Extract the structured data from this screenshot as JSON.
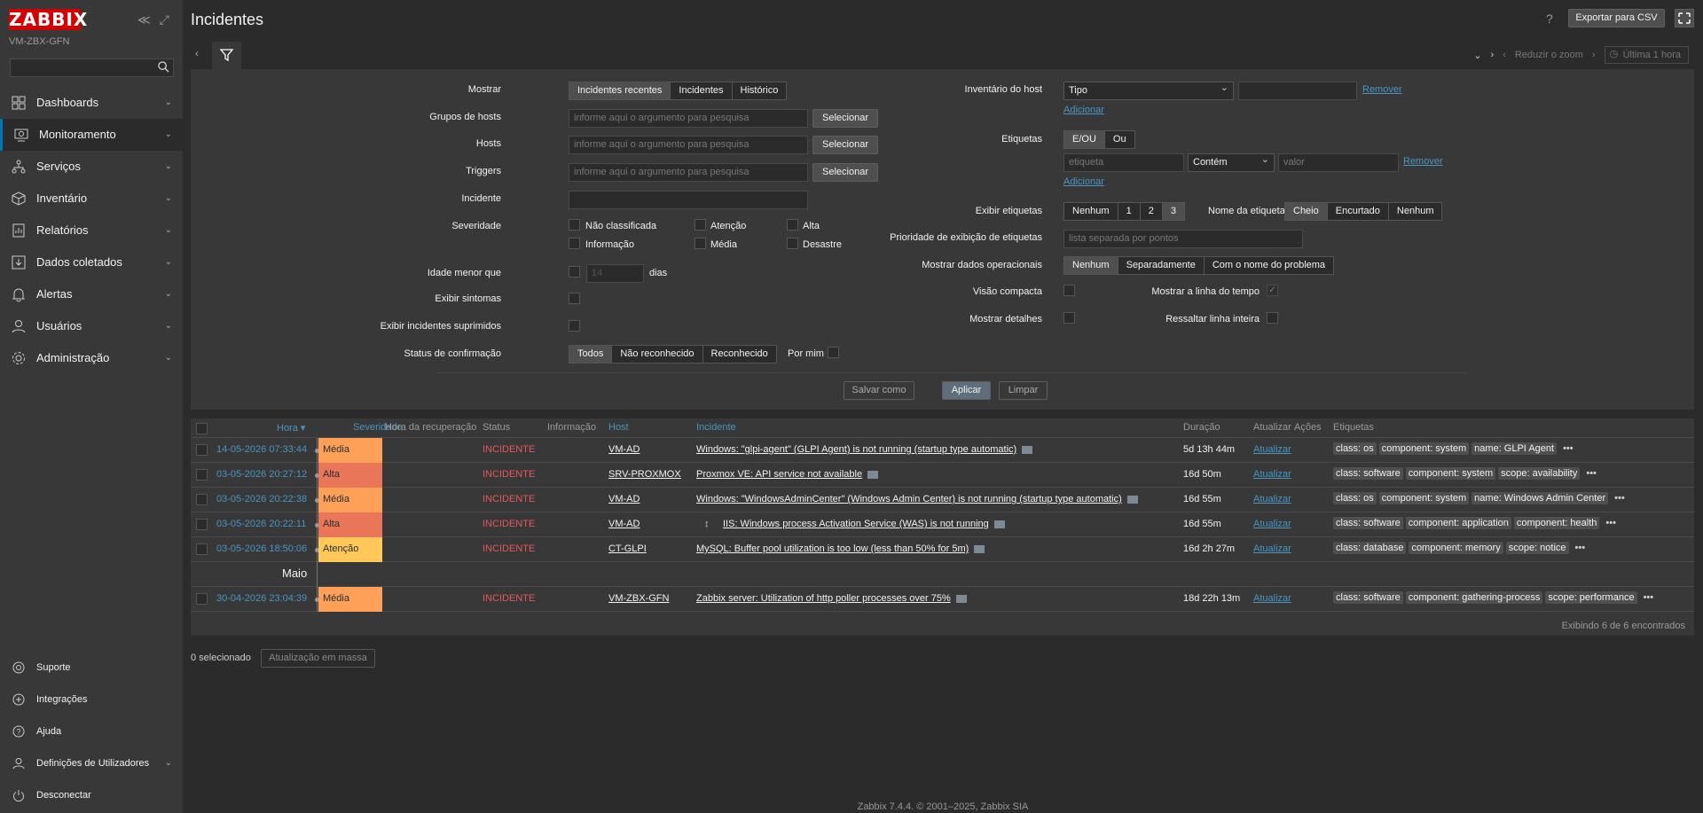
{
  "app": {
    "logo": "ZABBIX",
    "server": "VM-ZBX-GFN",
    "page_title": "Incidentes",
    "export": "Exportar para CSV",
    "help": "?"
  },
  "menu": [
    {
      "label": "Dashboards",
      "icon": "dashboards-icon"
    },
    {
      "label": "Monitoramento",
      "icon": "monitoring-icon",
      "active": true
    },
    {
      "label": "Serviços",
      "icon": "services-icon"
    },
    {
      "label": "Inventário",
      "icon": "inventory-icon"
    },
    {
      "label": "Relatórios",
      "icon": "reports-icon"
    },
    {
      "label": "Dados coletados",
      "icon": "data-collection-icon"
    },
    {
      "label": "Alertas",
      "icon": "alerts-icon"
    },
    {
      "label": "Usuários",
      "icon": "users-icon"
    },
    {
      "label": "Administração",
      "icon": "administration-icon"
    }
  ],
  "bottom_menu": [
    {
      "label": "Suporte",
      "icon": "support-icon"
    },
    {
      "label": "Integrações",
      "icon": "integrations-icon"
    },
    {
      "label": "Ajuda",
      "icon": "help-icon"
    },
    {
      "label": "Definições de Utilizadores",
      "icon": "user-settings-icon"
    },
    {
      "label": "Desconectar",
      "icon": "logout-icon"
    }
  ],
  "zoom": {
    "zoom_out": "Reduzir o zoom",
    "range": "Última 1 hora"
  },
  "filter": {
    "show_label": "Mostrar",
    "show_options": [
      "Incidentes recentes",
      "Incidentes",
      "Histórico"
    ],
    "host_groups_label": "Grupos de hosts",
    "hosts_label": "Hosts",
    "triggers_label": "Triggers",
    "placeholder": "informe aqui o argumento para pesquisa",
    "select": "Selecionar",
    "incident_label": "Incidente",
    "severity_label": "Severidade",
    "severities": [
      "Não classificada",
      "Atenção",
      "Alta",
      "Informação",
      "Média",
      "Desastre"
    ],
    "age_label": "Idade menor que",
    "age_value": "14",
    "age_unit": "dias",
    "symptoms_label": "Exibir sintomas",
    "suppressed_label": "Exibir incidentes suprimidos",
    "ack_label": "Status de confirmação",
    "ack_options": [
      "Todos",
      "Não reconhecido",
      "Reconhecido"
    ],
    "by_me": "Por mim",
    "inventory_label": "Inventário do host",
    "inventory_type": "Tipo",
    "remove": "Remover",
    "add": "Adicionar",
    "tags_label": "Etiquetas",
    "tags_ops": [
      "E/OU",
      "Ou"
    ],
    "tag_placeholder": "etiqueta",
    "tag_op": "Contém",
    "value_placeholder": "valor",
    "show_tags_label": "Exibir etiquetas",
    "show_tags_opts": [
      "Nenhum",
      "1",
      "2",
      "3"
    ],
    "tag_name_label": "Nome da etiqueta",
    "tag_name_opts": [
      "Cheio",
      "Encurtado",
      "Nenhum"
    ],
    "tag_priority_label": "Prioridade de exibição de etiquetas",
    "tag_priority_placeholder": "lista separada por pontos",
    "opdata_label": "Mostrar dados operacionais",
    "opdata_opts": [
      "Nenhum",
      "Separadamente",
      "Com o nome do problema"
    ],
    "compact_label": "Visão compacta",
    "timeline_label": "Mostrar a linha do tempo",
    "details_label": "Mostrar detalhes",
    "highlight_label": "Ressaltar linha inteira",
    "save_as": "Salvar como",
    "apply": "Aplicar",
    "reset": "Limpar"
  },
  "table": {
    "headers": [
      "Hora ▾",
      "Severidade",
      "Hora da recuperação",
      "Status",
      "Informação",
      "Host",
      "Incidente",
      "Duração",
      "Atualizar",
      "Ações",
      "Etiquetas"
    ],
    "rows": [
      {
        "time": "14-05-2026 07:33:44",
        "sev": "Média",
        "color": "#ffa059",
        "status": "INCIDENTE",
        "host": "VM-AD",
        "problem": "Windows: \"glpi-agent\" (GLPI Agent) is not running (startup type automatic)",
        "dur": "5d 13h 44m",
        "upd": "Atualizar",
        "tags": [
          "class: os",
          "component: system",
          "name: GLPI Agent"
        ]
      },
      {
        "time": "03-05-2026 20:27:12",
        "sev": "Alta",
        "color": "#e97659",
        "status": "INCIDENTE",
        "host": "SRV-PROXMOX",
        "problem": "Proxmox VE: API service not available",
        "dur": "16d 50m",
        "upd": "Atualizar",
        "tags": [
          "class: software",
          "component: system",
          "scope: availability"
        ]
      },
      {
        "time": "03-05-2026 20:22:38",
        "sev": "Média",
        "color": "#ffa059",
        "status": "INCIDENTE",
        "host": "VM-AD",
        "problem": "Windows: \"WindowsAdminCenter\" (Windows Admin Center) is not running (startup type automatic)",
        "dur": "16d 55m",
        "upd": "Atualizar",
        "tags": [
          "class: os",
          "component: system",
          "name: Windows Admin Center"
        ]
      },
      {
        "time": "03-05-2026 20:22:11",
        "sev": "Alta",
        "color": "#e97659",
        "status": "INCIDENTE",
        "host": "VM-AD",
        "problem": "IIS: Windows process Activation Service (WAS) is not running",
        "dur": "16d 55m",
        "upd": "Atualizar",
        "tags": [
          "class: software",
          "component: application",
          "component: health"
        ],
        "dep": true
      },
      {
        "time": "03-05-2026 18:50:06",
        "sev": "Atenção",
        "color": "#ffc859",
        "status": "INCIDENTE",
        "host": "CT-GLPI",
        "problem": "MySQL: Buffer pool utilization is too low (less than 50% for 5m)",
        "dur": "16d 2h 27m",
        "upd": "Atualizar",
        "tags": [
          "class: database",
          "component: memory",
          "scope: notice"
        ]
      },
      {
        "time": "30-04-2026 23:04:39",
        "sev": "Média",
        "color": "#ffa059",
        "status": "INCIDENTE",
        "host": "VM-ZBX-GFN",
        "problem": "Zabbix server: Utilization of http poller processes over 75%",
        "dur": "18d 22h 13m",
        "upd": "Atualizar",
        "tags": [
          "class: software",
          "component: gathering-process",
          "scope: performance"
        ]
      }
    ],
    "month_divider": "Maio",
    "footer": "Exibindo 6 de 6 encontrados"
  },
  "selected": "0 selecionado",
  "mass_update": "Atualização em massa",
  "copyright": "Zabbix 7.4.4. © 2001–2025, Zabbix SIA"
}
